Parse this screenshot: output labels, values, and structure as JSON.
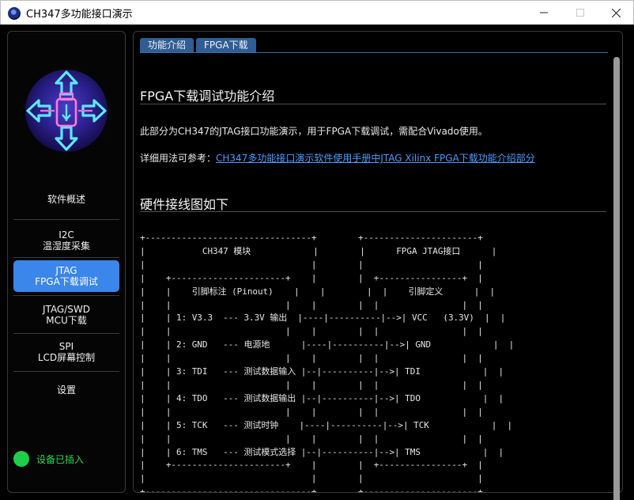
{
  "window": {
    "title": "CH347多功能接口演示"
  },
  "sidebar": {
    "items": [
      {
        "line1": "软件概述",
        "line2": ""
      },
      {
        "line1": "I2C",
        "line2": "温湿度采集"
      },
      {
        "line1": "JTAG",
        "line2": "FPGA下载调试"
      },
      {
        "line1": "JTAG/SWD",
        "line2": "MCU下载"
      },
      {
        "line1": "SPI",
        "line2": "LCD屏幕控制"
      },
      {
        "line1": "设置",
        "line2": ""
      }
    ],
    "active_index": 2,
    "status_text": "设备已插入"
  },
  "main": {
    "tabs": [
      "功能介绍",
      "FPGA下载"
    ],
    "heading1": "FPGA下载调试功能介绍",
    "para1": "此部分为CH347的JTAG接口功能演示，用于FPGA下载调试，需配合Vivado使用。",
    "para2_prefix": "详细用法可参考：",
    "para2_link": "CH347多功能接口演示软件使用手册中JTAG Xilinx FPGA下载功能介绍部分",
    "heading2": "硬件接线图如下",
    "diagram_lines": [
      "+--------------------------------+        +----------------------+",
      "|           CH347 模块            |        |      FPGA JTAG接口      |",
      "|                                |        |                      |",
      "|    +----------------------+    |        |  +----------------+  |",
      "|    |    引脚标注 (Pinout)    |    |        |  |    引脚定义      |  |",
      "|    |                      |    |        |  |                |  |",
      "|    | 1: V3.3  --- 3.3V 输出  |----|----------|-->| VCC   (3.3V)  |  |",
      "|    |                      |    |        |  |                |  |",
      "|    | 2: GND   --- 电源地      |----|----------|-->| GND            |  |",
      "|    |                      |    |        |  |                |  |",
      "|    | 3: TDI   --- 测试数据输入 |--|----------|-->| TDI            |  |",
      "|    |                      |    |        |  |                |  |",
      "|    | 4: TDO   --- 测试数据输出 |--|----------|-->| TDO            |  |",
      "|    |                      |    |        |  |                |  |",
      "|    | 5: TCK   --- 测试时钟    |----|----------|-->| TCK            |  |",
      "|    |                      |    |        |  |                |  |",
      "|    | 6: TMS   --- 测试模式选择 |--|----------|-->| TMS            |  |",
      "|    +----------------------+    |        |  +----------------+  |",
      "|                                |        |                      |",
      "+--------------------------------+        +----------------------+"
    ]
  },
  "icons": {
    "app": "app-logo-icon",
    "minimize": "minimize-icon",
    "maximize": "maximize-icon",
    "close": "close-icon",
    "logo": "usb-arrows-logo-icon"
  },
  "colors": {
    "accent": "#3a86ea",
    "tab": "#2f5d95",
    "link": "#4a9bff",
    "status": "#1fcf4a",
    "background": "#000000"
  }
}
